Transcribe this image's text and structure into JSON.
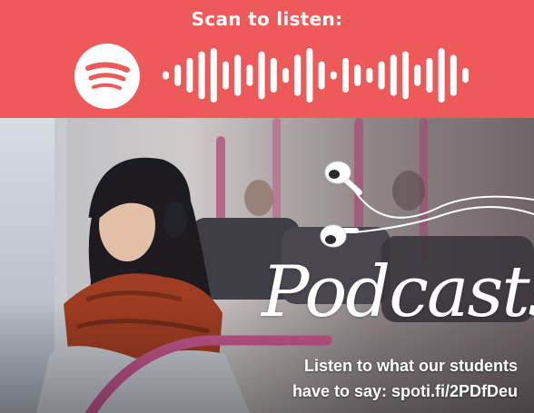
{
  "banner": {
    "scan_label": "Scan to listen:",
    "background_color": "#EE5A5A",
    "logo_icon": "spotify-logo-icon",
    "code_icon": "spotify-scannable-code"
  },
  "hero": {
    "title": "Podcasts",
    "caption_line1": "Listen to what our students",
    "caption_line2_prefix": "have to say: ",
    "caption_link": "spoti.fi/2PDfDeu",
    "decor_icon": "earphones-icon"
  }
}
